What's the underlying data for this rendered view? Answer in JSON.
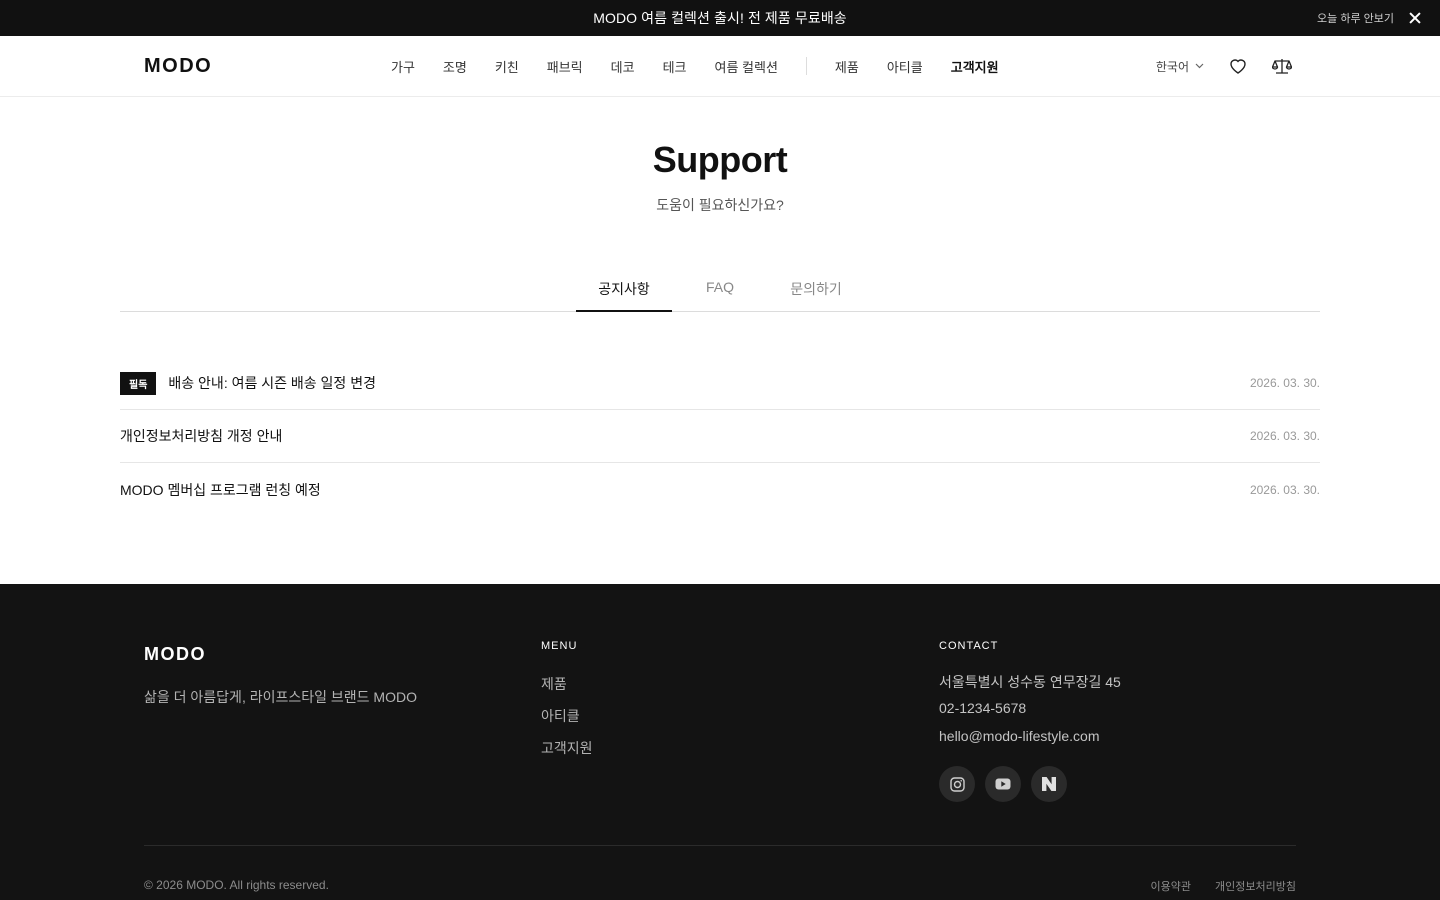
{
  "announcement": {
    "message": "MODO 여름 컬렉션 출시! 전 제품 무료배송",
    "hide_today": "오늘 하루 안보기"
  },
  "header": {
    "logo": "MODO",
    "nav_categories": [
      "가구",
      "조명",
      "키친",
      "패브릭",
      "데코",
      "테크",
      "여름 컬렉션"
    ],
    "nav_pages": [
      "제품",
      "아티클",
      "고객지원"
    ],
    "active_page": "고객지원",
    "language": "한국어"
  },
  "hero": {
    "title": "Support",
    "subtitle": "도움이 필요하신가요?"
  },
  "tabs": [
    {
      "label": "공지사항",
      "active": true
    },
    {
      "label": "FAQ",
      "active": false
    },
    {
      "label": "문의하기",
      "active": false
    }
  ],
  "notices": [
    {
      "badge": "필독",
      "title": "배송 안내: 여름 시즌 배송 일정 변경",
      "date": "2026. 03. 30."
    },
    {
      "badge": "",
      "title": "개인정보처리방침 개정 안내",
      "date": "2026. 03. 30."
    },
    {
      "badge": "",
      "title": "MODO 멤버십 프로그램 런칭 예정",
      "date": "2026. 03. 30."
    }
  ],
  "footer": {
    "logo": "MODO",
    "tagline": "삶을 더 아름답게, 라이프스타일 브랜드 MODO",
    "menu_heading": "MENU",
    "menu_items": [
      "제품",
      "아티클",
      "고객지원"
    ],
    "contact_heading": "CONTACT",
    "address": "서울특별시 성수동 연무장길 45",
    "phone": "02-1234-5678",
    "email": "hello@modo-lifestyle.com",
    "social_icons": [
      "instagram-icon",
      "youtube-icon",
      "naver-icon"
    ],
    "copyright": "© 2026 MODO. All rights reserved.",
    "legal_links": [
      "이용약관",
      "개인정보처리방침"
    ]
  }
}
